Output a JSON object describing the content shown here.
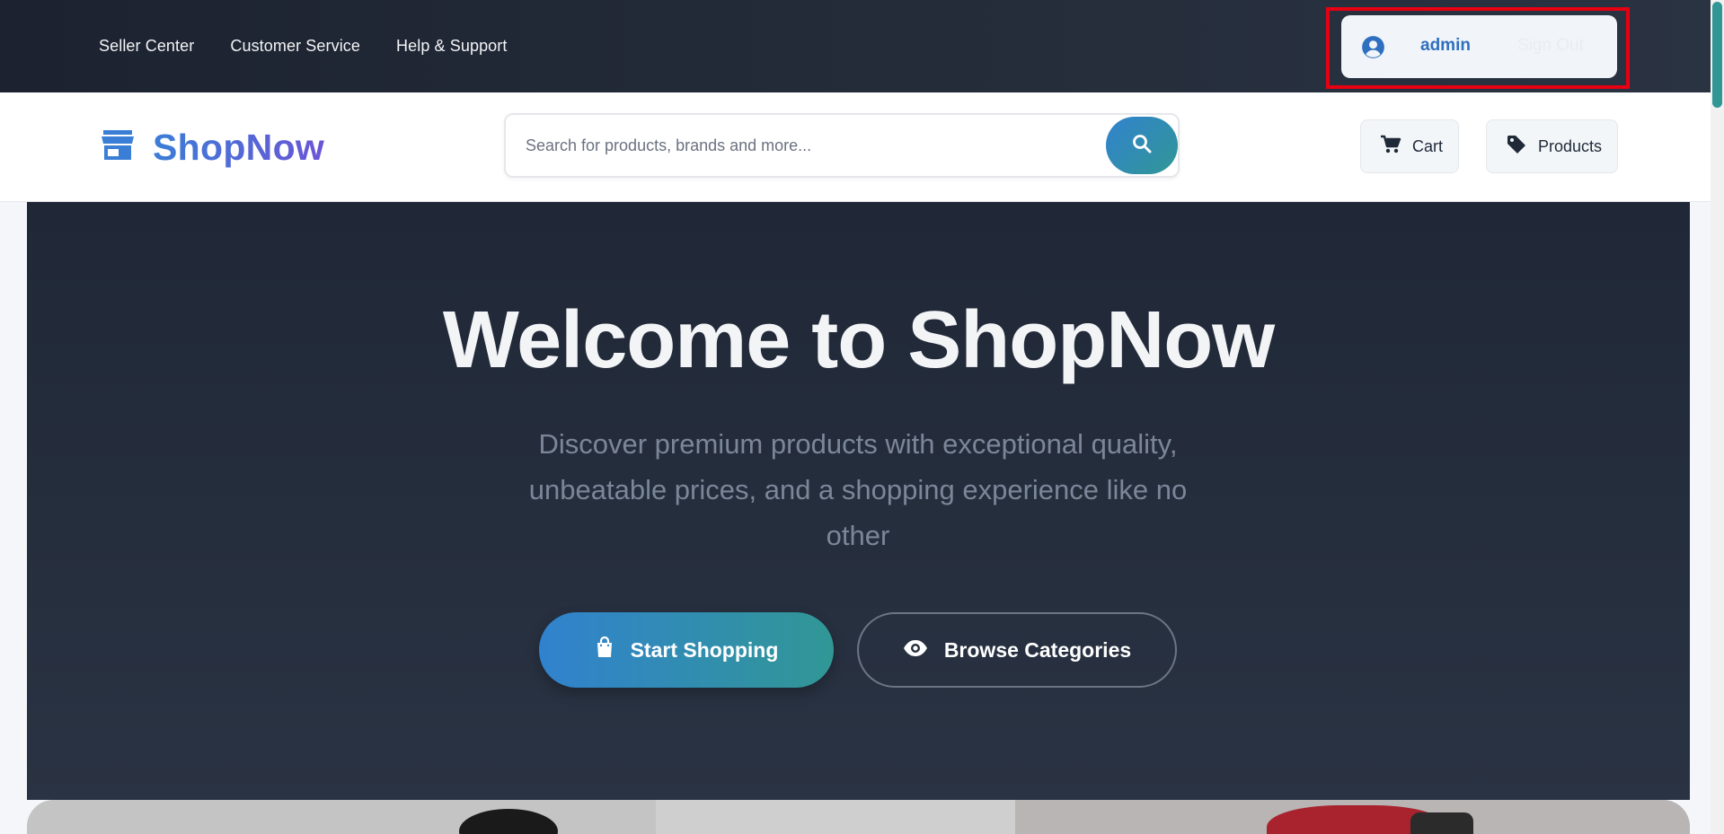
{
  "topbar": {
    "links": [
      "Seller Center",
      "Customer Service",
      "Help & Support"
    ],
    "user": {
      "name": "admin",
      "signout": "Sign Out"
    }
  },
  "header": {
    "logo": "ShopNow",
    "search": {
      "placeholder": "Search for products, brands and more..."
    },
    "cart_label": "Cart",
    "products_label": "Products"
  },
  "hero": {
    "title": "Welcome to ShopNow",
    "subtitle": "Discover premium products with exceptional quality, unbeatable prices, and a shopping experience like no other",
    "primary_cta": "Start Shopping",
    "secondary_cta": "Browse Categories"
  },
  "colors": {
    "accent_blue": "#3182ce",
    "accent_teal": "#319795",
    "dark_bg": "#202838",
    "highlight_red": "#e60012"
  },
  "icons": [
    "user-circle-icon",
    "store-icon",
    "search-icon",
    "cart-icon",
    "tag-icon",
    "shopping-bag-icon",
    "eye-icon"
  ]
}
